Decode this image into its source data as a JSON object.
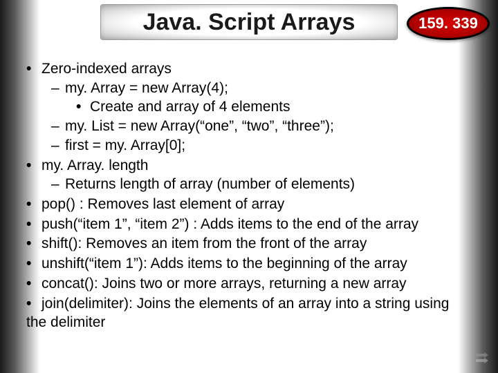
{
  "header": {
    "title": "Java. Script Arrays",
    "badge": "159. 339"
  },
  "bullets": {
    "b1_0": "Zero-indexed arrays",
    "b1_0_s0": "my. Array = new Array(4);",
    "b1_0_s0_s0": "Create and array of 4 elements",
    "b1_0_s1": "my. List = new Array(“one”, “two”, “three”);",
    "b1_0_s2": "first = my. Array[0];",
    "b1_1": "my. Array. length",
    "b1_1_s0": "Returns length of array (number of elements)",
    "b1_2": "pop()  : Removes last element of array",
    "b1_3": "push(“item 1”, “item 2”)  : Adds items to the end of the array",
    "b1_4": "shift(): Removes an item from the front of the array",
    "b1_5": "unshift(“item 1”): Adds items to the beginning of the array",
    "b1_6": "concat(): Joins two or more arrays, returning a new array",
    "b1_7": "join(delimiter): Joins the elements of an array into a string using the delimiter"
  }
}
